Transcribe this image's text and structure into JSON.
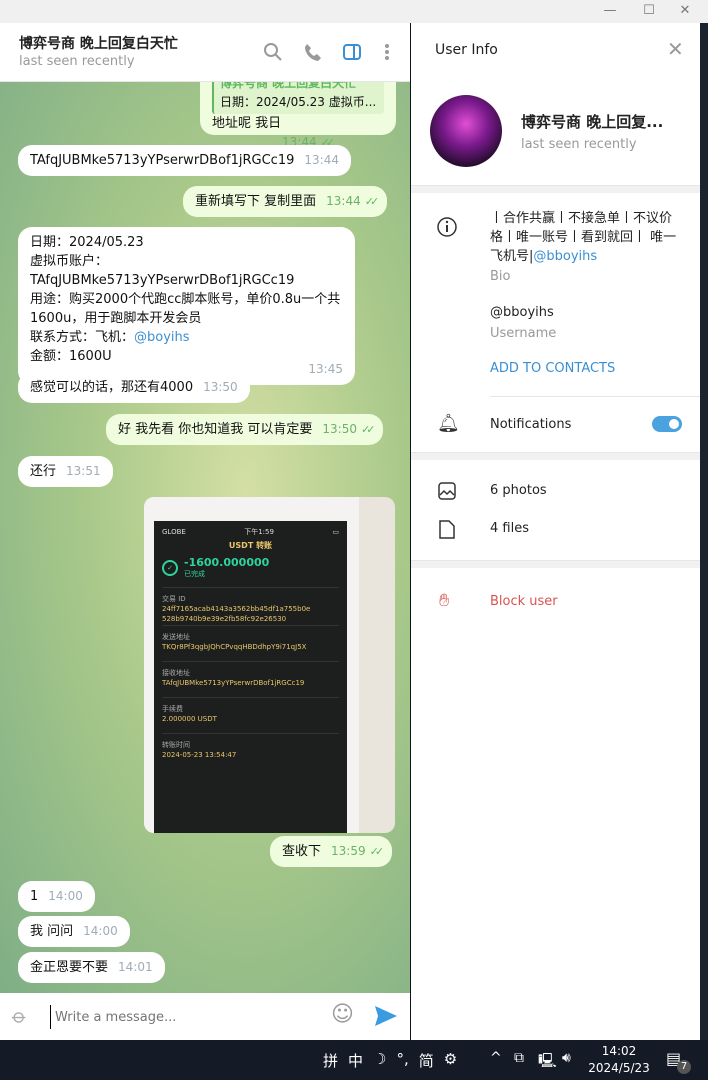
{
  "window": {
    "controls": [
      "minimize",
      "maximize",
      "close"
    ]
  },
  "chat": {
    "title": "博弈号商 晚上回复白天忙",
    "status": "last seen recently",
    "header_icons": [
      "search-icon",
      "phone-icon",
      "sidebar-toggle-icon",
      "more-vertical-icon"
    ],
    "reply_quote": {
      "name": "博弈号商 晚上回复白天忙",
      "text": "日期：2024/05.23 虚拟币..."
    },
    "messages": [
      {
        "dir": "out",
        "text": "地址呢 我日",
        "time": "13:44"
      },
      {
        "dir": "in",
        "text": "TAfqJUBMke5713yYPserwrDBof1jRGCc19",
        "time": "13:44"
      },
      {
        "dir": "out",
        "text": "重新填写下  复制里面",
        "time": "13:44"
      },
      {
        "dir": "in",
        "lines": [
          "日期：2024/05.23",
          "虚拟币账户：",
          "TAfqJUBMke5713yYPserwrDBof1jRGCc19",
          "用途：购买2000个代跑cc脚本账号，单价0.8u一个共",
          "1600u，用于跑脚本开发会员",
          "联系方式：飞机：",
          "金额：1600U"
        ],
        "link": "@boyihs",
        "time": "13:45"
      },
      {
        "dir": "in",
        "text": "感觉可以的话，那还有4000",
        "time": "13:50"
      },
      {
        "dir": "out",
        "text": "好  我先看 你也知道我 可以肯定要",
        "time": "13:50"
      },
      {
        "dir": "in",
        "text": "还行",
        "time": "13:51"
      },
      {
        "dir": "out",
        "text": "查收下",
        "time": "13:59"
      },
      {
        "dir": "in",
        "text": "1",
        "time": "14:00"
      },
      {
        "dir": "in",
        "text": "我 问问",
        "time": "14:00"
      },
      {
        "dir": "in",
        "text": "金正恩要不要",
        "time": "14:01"
      }
    ],
    "photo": {
      "status_bar": "GLOBE",
      "clock": "下午1:59",
      "title": "USDT 转账",
      "amount": "-1600.000000",
      "state": "已完成",
      "fields": [
        {
          "label": "交易 ID",
          "value": "24ff7165acab4143a3562bb45df1a755b0e 528b9740b9e39e2fb58fc92e26530"
        },
        {
          "label": "发送地址",
          "value": "TKQr8Pf3qgbJQhCPvqqHBDdhpY9i71qJ5X"
        },
        {
          "label": "接收地址",
          "value": "TAfqJUBMke5713yYPserwrDBof1jRGCc19"
        },
        {
          "label": "手续费",
          "value": "2.000000 USDT"
        },
        {
          "label": "转账时间",
          "value": "2024-05-23 13:54:47"
        }
      ]
    },
    "composer": {
      "placeholder": "Write a message..."
    }
  },
  "user_info": {
    "title": "User Info",
    "name": "博弈号商 晚上回复...",
    "status": "last seen recently",
    "bio": "丨合作共赢丨不接急单丨不议价格丨唯一账号丨看到就回丨 唯一飞机号|",
    "bio_link": "@bboyihs",
    "bio_label": "Bio",
    "username": "@bboyihs",
    "username_label": "Username",
    "add_contacts": "ADD TO CONTACTS",
    "notifications": "Notifications",
    "notifications_on": true,
    "photos": "6 photos",
    "files": "4 files",
    "block": "Block user",
    "accent": "#3a8fd3",
    "danger": "#d9534f"
  },
  "taskbar": {
    "ime": [
      "拼",
      "中",
      "☽",
      "°,",
      "简",
      "⚙"
    ],
    "time": "14:02",
    "date": "2024/5/23",
    "notification_count": "7"
  }
}
